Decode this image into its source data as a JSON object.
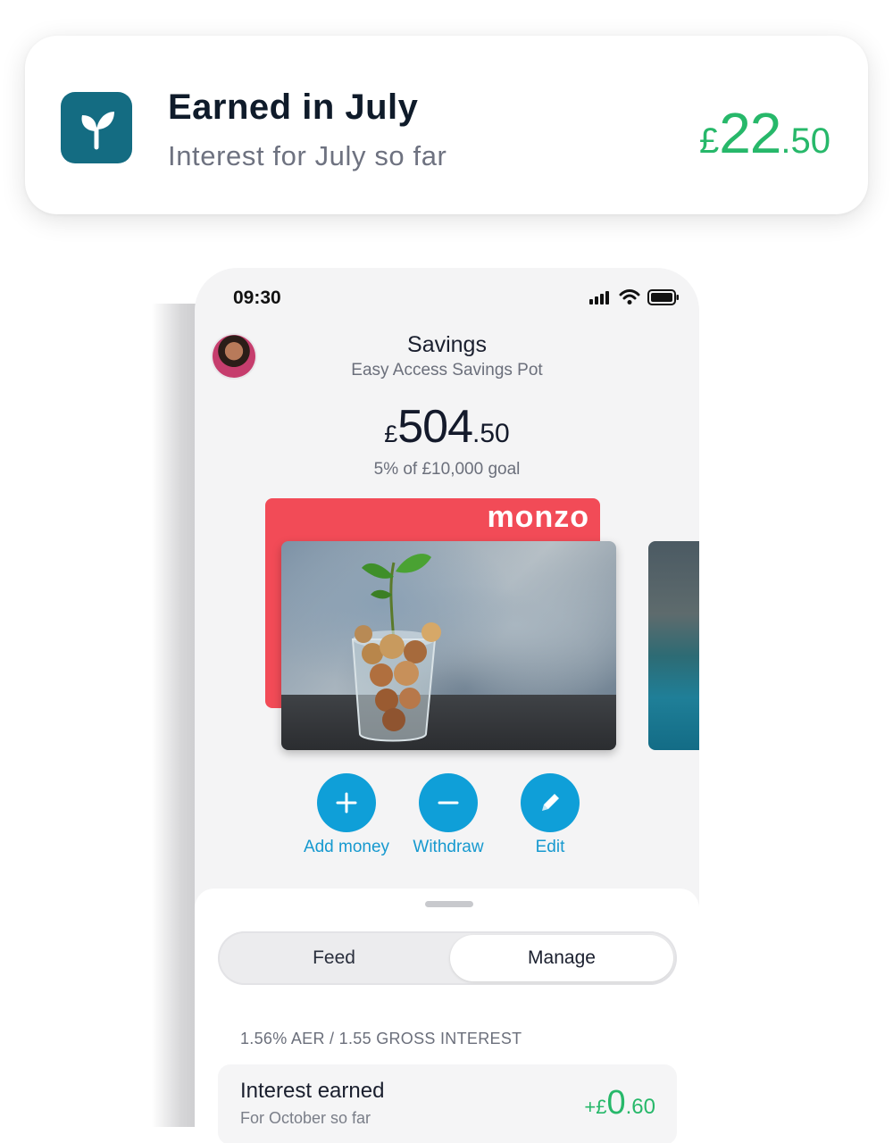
{
  "notification": {
    "icon": "sprout-icon",
    "title": "Earned in July",
    "subtitle": "Interest for July so far",
    "amount": {
      "currency": "£",
      "whole": "22",
      "fraction": ".50"
    }
  },
  "phone": {
    "status": {
      "time": "09:30",
      "icons": [
        "signal-icon",
        "wifi-icon",
        "battery-icon"
      ]
    },
    "header": {
      "title": "Savings",
      "subtitle": "Easy Access Savings Pot"
    },
    "balance": {
      "currency": "£",
      "whole": "504",
      "fraction": ".50"
    },
    "goal_text": "5% of £10,000 goal",
    "card": {
      "brand": "monzo"
    },
    "actions": [
      {
        "label": "Add money",
        "icon": "plus-icon"
      },
      {
        "label": "Withdraw",
        "icon": "minus-icon"
      },
      {
        "label": "Edit",
        "icon": "pencil-icon"
      }
    ],
    "tabs": {
      "feed": "Feed",
      "manage": "Manage",
      "selected": "Manage"
    },
    "rate_text": "1.56% AER / 1.55 GROSS INTEREST",
    "interest": {
      "title": "Interest earned",
      "subtitle": "For October so far",
      "amount": {
        "sign": "+£",
        "whole": "0",
        "fraction": ".60"
      }
    }
  },
  "colors": {
    "accent_blue": "#0f9fd8",
    "positive_green": "#27b86a",
    "brand_red": "#f24b57",
    "icon_teal": "#146c82"
  }
}
